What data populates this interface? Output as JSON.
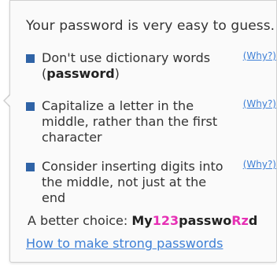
{
  "tooltip": {
    "headline": "Your password is very easy to guess.",
    "tips": [
      {
        "text_before": "Don't use dictionary words (",
        "bold": "password",
        "text_after": ")",
        "link": "(Why?)"
      },
      {
        "text_before": "Capitalize a letter in the middle, rather than the first character",
        "bold": "",
        "text_after": "",
        "link": "(Why?)"
      },
      {
        "text_before": "Consider inserting digits into the middle, not just at the end",
        "bold": "",
        "text_after": "",
        "link": "(Why?)"
      }
    ],
    "better_choice": {
      "label": "A better choice: ",
      "pw_1": "My",
      "pw_2": "123",
      "pw_3": "passwo",
      "pw_4": "Rz",
      "pw_5": "d"
    },
    "strong_link": "How to make strong passwords"
  },
  "colors": {
    "bullet": "#2f63a6",
    "link": "#3d7fd6",
    "highlight": "#e62fb4"
  }
}
